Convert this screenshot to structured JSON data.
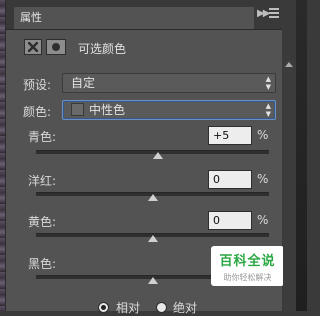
{
  "panel": {
    "tab_label": "属性",
    "collapse_icon": "double-chevron-right",
    "menu_icon": "panel-menu"
  },
  "header": {
    "adjustment_icon": "selective-color-adjustment",
    "mask_icon": "layer-mask",
    "title": "可选颜色"
  },
  "preset": {
    "label": "预设:",
    "value": "自定"
  },
  "colors": {
    "label": "颜色:",
    "value": "中性色",
    "swatch_color": "#6a6a6a"
  },
  "sliders": [
    {
      "label": "青色:",
      "value": "+5",
      "unit": "%",
      "level": 0.525
    },
    {
      "label": "洋红:",
      "value": "0",
      "unit": "%",
      "level": 0.5
    },
    {
      "label": "黄色:",
      "value": "0",
      "unit": "%",
      "level": 0.5
    },
    {
      "label": "黑色:",
      "value": "0",
      "unit": "%",
      "level": 0.5
    }
  ],
  "method": {
    "options": [
      {
        "label": "相对",
        "selected": true
      },
      {
        "label": "绝对",
        "selected": false
      }
    ]
  },
  "watermark": {
    "title": "百科全说",
    "subtitle": "助你轻松解决"
  },
  "colors_theme": {
    "panel_bg": "#535353",
    "focus": "#6f8fbf"
  }
}
